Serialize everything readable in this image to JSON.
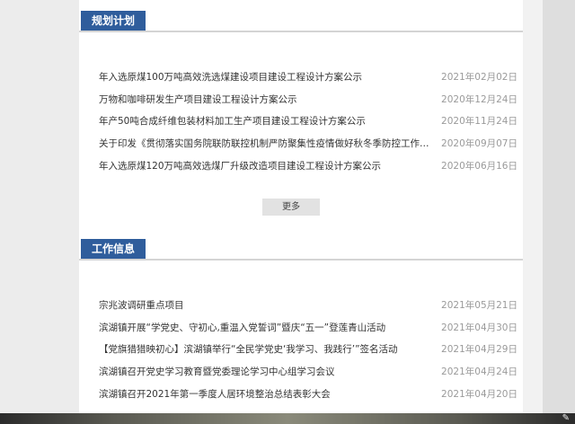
{
  "planning": {
    "header": "规划计划",
    "items": [
      {
        "title": "年入选原煤100万吨高效洗选煤建设项目建设工程设计方案公示",
        "date": "2021年02月02日"
      },
      {
        "title": "万物和咖啡研发生产项目建设工程设计方案公示",
        "date": "2020年12月24日"
      },
      {
        "title": "年产50吨合成纤维包装材料加工生产项目建设工程设计方案公示",
        "date": "2020年11月24日"
      },
      {
        "title": "关于印发《贯彻落实国务院联防联控机制严防聚集性疫情做好秋冬季防控工作电...",
        "date": "2020年09月07日"
      },
      {
        "title": "年入选原煤120万吨高效选煤厂升级改造项目建设工程设计方案公示",
        "date": "2020年06月16日"
      }
    ],
    "more_label": "更多"
  },
  "work": {
    "header": "工作信息",
    "items": [
      {
        "title": "宗兆波调研重点项目",
        "date": "2021年05月21日"
      },
      {
        "title": "滨湖镇开展“学党史、守初心,重温入党誓词”暨庆“五一”登莲青山活动",
        "date": "2021年04月30日"
      },
      {
        "title": "【党旗猎猎映初心】滨湖镇举行“全民学党史‘我学习、我践行’”签名活动",
        "date": "2021年04月29日"
      },
      {
        "title": "滨湖镇召开党史学习教育暨党委理论学习中心组学习会议",
        "date": "2021年04月24日"
      },
      {
        "title": "滨湖镇召开2021年第一季度人居环境整治总结表彰大会",
        "date": "2021年04月20日"
      }
    ]
  },
  "icons": {
    "tray": "pen-icon"
  }
}
